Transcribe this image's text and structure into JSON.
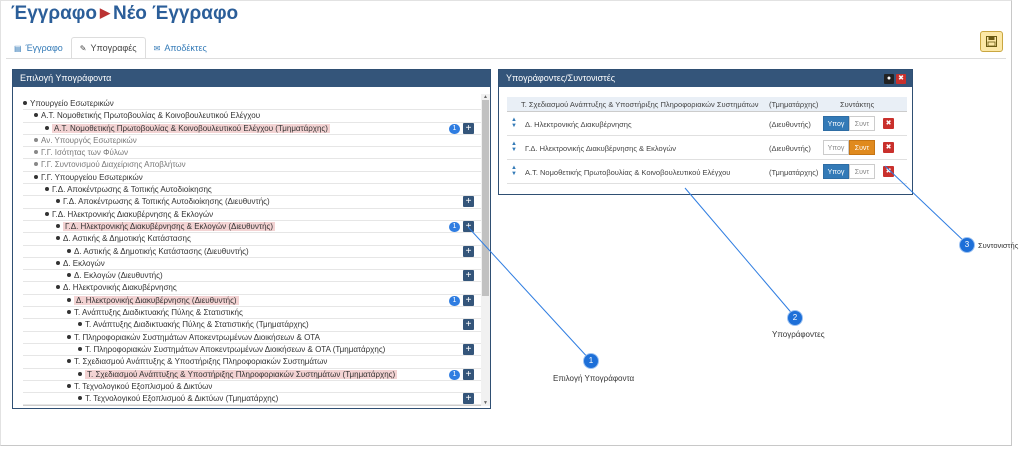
{
  "header": {
    "title_part1": "Έγγραφο",
    "title_part2": "Νέο Έγγραφο"
  },
  "tabs": [
    {
      "label": "Έγγραφο",
      "icon": "file-icon"
    },
    {
      "label": "Υπογραφές",
      "icon": "pencil-icon",
      "active": true
    },
    {
      "label": "Αποδέκτες",
      "icon": "envelope-icon"
    }
  ],
  "save_button": {
    "icon": "floppy-disk-icon"
  },
  "left_panel": {
    "title": "Επιλογή Υπογράφοντα",
    "tree": [
      {
        "label": "Υπουργείο Εσωτερικών",
        "level": 0
      },
      {
        "label": "Α.Τ. Νομοθετικής Πρωτοβουλίας & Κοινοβουλευτικού Ελέγχου",
        "level": 1
      },
      {
        "label": "Α.Τ. Νομοθετικής Πρωτοβουλίας & Κοινοβουλευτικού Ελέγχου (Τμηματάρχης)",
        "level": 2,
        "highlight": true,
        "badge": "1",
        "plus": true
      },
      {
        "label": "Αν. Υπουργός Εσωτερικών",
        "level": 1,
        "grey": true
      },
      {
        "label": "Γ.Γ. Ισότητας των Φύλων",
        "level": 1,
        "grey": true
      },
      {
        "label": "Γ.Γ. Συντονισμού Διαχείρισης Αποβλήτων",
        "level": 1,
        "grey": true
      },
      {
        "label": "Γ.Γ. Υπουργείου Εσωτερικών",
        "level": 1
      },
      {
        "label": "Γ.Δ. Αποκέντρωσης & Τοπικής Αυτοδιοίκησης",
        "level": 2
      },
      {
        "label": "Γ.Δ. Αποκέντρωσης & Τοπικής Αυτοδιοίκησης (Διευθυντής)",
        "level": 3,
        "plus": true
      },
      {
        "label": "Γ.Δ. Ηλεκτρονικής Διακυβέρνησης & Εκλογών",
        "level": 2
      },
      {
        "label": "Γ.Δ. Ηλεκτρονικής Διακυβέρνησης & Εκλογών (Διευθυντής)",
        "level": 3,
        "highlight": true,
        "badge": "1",
        "plus": true
      },
      {
        "label": "Δ. Αστικής & Δημοτικής Κατάστασης",
        "level": 3
      },
      {
        "label": "Δ. Αστικής & Δημοτικής Κατάστασης (Διευθυντής)",
        "level": 4,
        "plus": true
      },
      {
        "label": "Δ. Εκλογών",
        "level": 3
      },
      {
        "label": "Δ. Εκλογών (Διευθυντής)",
        "level": 4,
        "plus": true
      },
      {
        "label": "Δ. Ηλεκτρονικής Διακυβέρνησης",
        "level": 3
      },
      {
        "label": "Δ. Ηλεκτρονικής Διακυβέρνησης (Διευθυντής)",
        "level": 4,
        "highlight": true,
        "badge": "1",
        "plus": true
      },
      {
        "label": "Τ. Ανάπτυξης Διαδικτυακής Πύλης & Στατιστικής",
        "level": 4
      },
      {
        "label": "Τ. Ανάπτυξης Διαδικτυακής Πύλης & Στατιστικής (Τμηματάρχης)",
        "level": 5,
        "plus": true
      },
      {
        "label": "Τ. Πληροφοριακών Συστημάτων Αποκεντρωμένων Διοικήσεων & ΟΤΑ",
        "level": 4
      },
      {
        "label": "Τ. Πληροφοριακών Συστημάτων Αποκεντρωμένων Διοικήσεων & ΟΤΑ (Τμηματάρχης)",
        "level": 5,
        "plus": true
      },
      {
        "label": "Τ. Σχεδιασμού Ανάπτυξης & Υποστήριξης Πληροφοριακών Συστημάτων",
        "level": 4
      },
      {
        "label": "Τ. Σχεδιασμού Ανάπτυξης & Υποστήριξης Πληροφοριακών Συστημάτων (Τμηματάρχης)",
        "level": 5,
        "highlight": true,
        "badge": "1",
        "plus": true
      },
      {
        "label": "Τ. Τεχνολογικού Εξοπλισμού & Δικτύων",
        "level": 4
      },
      {
        "label": "Τ. Τεχνολογικού Εξοπλισμού & Δικτύων (Τμηματάρχης)",
        "level": 5,
        "plus": true
      }
    ]
  },
  "right_panel": {
    "title": "Υπογράφοντες/Συντονιστές",
    "header_cols": {
      "unit": "Τ. Σχεδιασμού Ανάπτυξης & Υποστήριξης Πληροφοριακών Συστημάτων",
      "role": "(Τμηματάρχης)",
      "composer": "Συντάκτης"
    },
    "rows": [
      {
        "unit": "Δ. Ηλεκτρονικής Διακυβέρνησης",
        "role": "(Διευθυντής)",
        "sign": "Υπογ",
        "coord": "Συντ",
        "active": "sign"
      },
      {
        "unit": "Γ.Δ. Ηλεκτρονικής Διακυβέρνησης & Εκλογών",
        "role": "(Διευθυντής)",
        "sign": "Υπογ",
        "coord": "Συντ",
        "active": "coord"
      },
      {
        "unit": "Α.Τ. Νομοθετικής Πρωτοβουλίας & Κοινοβουλευτικού Ελέγχου",
        "role": "(Τμηματάρχης)",
        "sign": "Υπογ",
        "coord": "Συντ",
        "active": "sign"
      }
    ]
  },
  "callouts": [
    {
      "number": "1",
      "label": "Επιλογή Υπογράφοντα"
    },
    {
      "number": "2",
      "label": "Υπογράφοντες"
    },
    {
      "number": "3",
      "label": "Συντονιστής"
    }
  ],
  "colors": {
    "header_blue": "#34557a",
    "title_blue": "#2b5e99",
    "highlight": "#f3d3d3",
    "sign_blue": "#337ab7",
    "coord_orange": "#e08a1e",
    "delete_red": "#c9302c",
    "callout_blue": "#1d6fd8"
  }
}
